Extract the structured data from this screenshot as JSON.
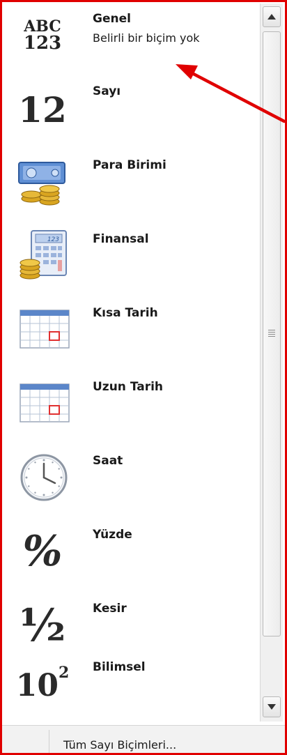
{
  "formats": [
    {
      "label": "Genel",
      "sublabel": "Belirli bir biçim yok",
      "icon": "abc-123-icon"
    },
    {
      "label": "Sayı",
      "icon": "number-12-icon",
      "glyph": "12"
    },
    {
      "label": "Para Birimi",
      "icon": "currency-banknote-coins-icon"
    },
    {
      "label": "Finansal",
      "icon": "accounting-calculator-coins-icon"
    },
    {
      "label": "Kısa Tarih",
      "icon": "calendar-icon"
    },
    {
      "label": "Uzun Tarih",
      "icon": "calendar-icon"
    },
    {
      "label": "Saat",
      "icon": "clock-icon"
    },
    {
      "label": "Yüzde",
      "icon": "percent-icon",
      "glyph": "%"
    },
    {
      "label": "Kesir",
      "icon": "fraction-half-icon",
      "glyph": "½"
    },
    {
      "label": "Bilimsel",
      "icon": "scientific-ten-squared-icon",
      "glyph": "10",
      "superscript": "2"
    }
  ],
  "icon_text": {
    "abc": "ABC",
    "digits": "123",
    "finance_digits": "123"
  },
  "footer": {
    "more_formats": "Tüm Sayı Biçimleri..."
  },
  "colors": {
    "frame": "#e00000",
    "arrow": "#e00000",
    "text": "#1a1a1a",
    "coin": "#d9a520",
    "calendar_blue": "#5b86c9"
  }
}
